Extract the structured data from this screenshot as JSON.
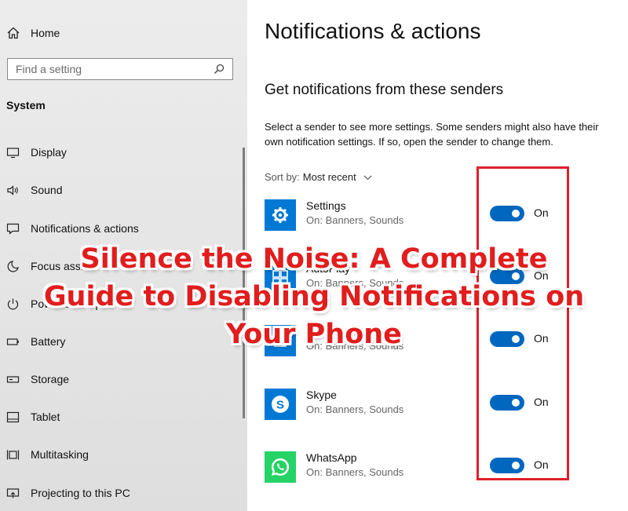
{
  "sidebar": {
    "home_label": "Home",
    "search_placeholder": "Find a setting",
    "section": "System",
    "items": [
      {
        "label": "Display",
        "icon": "display-icon"
      },
      {
        "label": "Sound",
        "icon": "sound-icon"
      },
      {
        "label": "Notifications & actions",
        "icon": "notifications-icon"
      },
      {
        "label": "Focus assist",
        "icon": "moon-icon"
      },
      {
        "label": "Power & sleep",
        "icon": "power-icon"
      },
      {
        "label": "Battery",
        "icon": "battery-icon"
      },
      {
        "label": "Storage",
        "icon": "storage-icon"
      },
      {
        "label": "Tablet",
        "icon": "tablet-icon"
      },
      {
        "label": "Multitasking",
        "icon": "multitasking-icon"
      },
      {
        "label": "Projecting to this PC",
        "icon": "projecting-icon"
      }
    ]
  },
  "main": {
    "title": "Notifications & actions",
    "subheader": "Get notifications from these senders",
    "description": "Select a sender to see more settings. Some senders might also have their own notification settings. If so, open the sender to change them.",
    "sort_label": "Sort by:",
    "sort_value": "Most recent",
    "senders": [
      {
        "name": "Settings",
        "detail": "On: Banners, Sounds",
        "state": "On",
        "icon": "settings-gear-icon",
        "color": "#0078d4"
      },
      {
        "name": "AutoPlay",
        "detail": "On: Banners, Sounds",
        "state": "On",
        "icon": "autoplay-icon",
        "color": "#0078d4"
      },
      {
        "name": "d",
        "detail": "On: Banners, Sounds",
        "state": "On",
        "icon": "app-icon",
        "color": "#0078d4"
      },
      {
        "name": "Skype",
        "detail": "On: Banners, Sounds",
        "state": "On",
        "icon": "skype-icon",
        "color": "#0078d4"
      },
      {
        "name": "WhatsApp",
        "detail": "On: Banners, Sounds",
        "state": "On",
        "icon": "whatsapp-icon",
        "color": "#25d366"
      }
    ]
  },
  "overlay": {
    "headline": "Silence the Noise: A Complete Guide to Disabling Notifications on Your Phone"
  },
  "colors": {
    "accent": "#0067c0",
    "highlight_box": "#e0202a",
    "headline": "#e11d1d"
  }
}
